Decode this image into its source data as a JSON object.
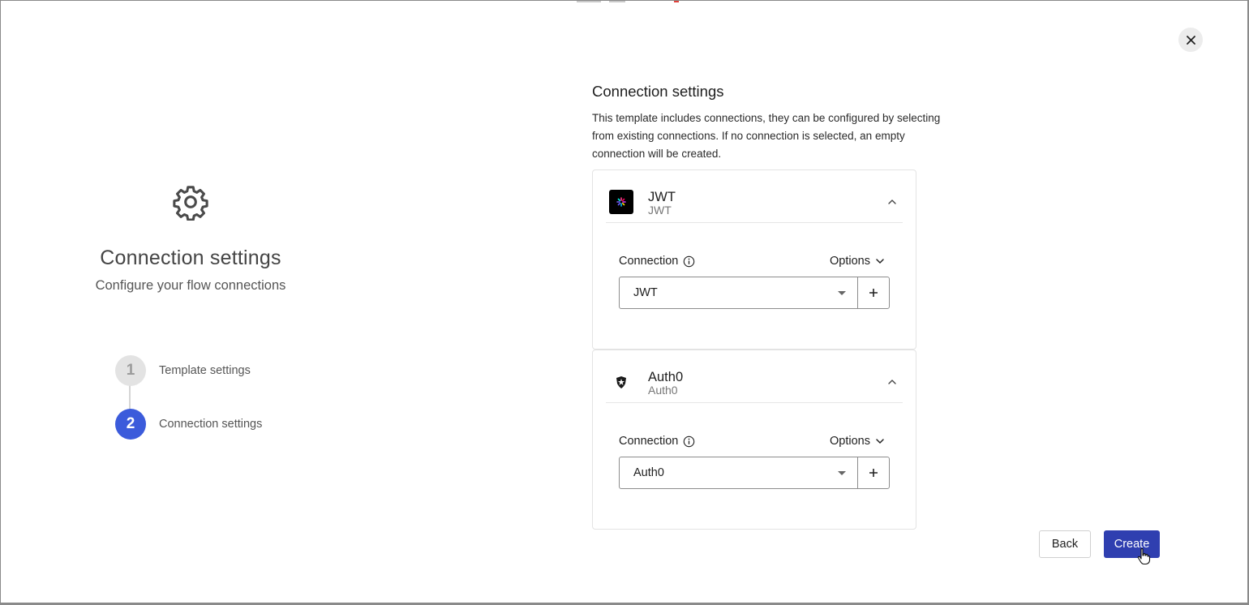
{
  "dialog": {
    "close_icon": "close-icon"
  },
  "left": {
    "icon": "gear-icon",
    "title": "Connection settings",
    "subtitle": "Configure your flow connections",
    "steps": [
      {
        "number": "1",
        "label": "Template settings",
        "state": "done"
      },
      {
        "number": "2",
        "label": "Connection settings",
        "state": "active"
      }
    ]
  },
  "right": {
    "title": "Connection settings",
    "description": "This template includes connections, they can be configured by selecting from existing connections. If no connection is selected, an empty connection will be created.",
    "connections": [
      {
        "name": "JWT",
        "type": "JWT",
        "icon": "jwt-logo-icon",
        "connection_label": "Connection",
        "options_label": "Options",
        "selected": "JWT"
      },
      {
        "name": "Auth0",
        "type": "Auth0",
        "icon": "auth0-logo-icon",
        "connection_label": "Connection",
        "options_label": "Options",
        "selected": "Auth0"
      }
    ]
  },
  "footer": {
    "back_label": "Back",
    "create_label": "Create"
  },
  "colors": {
    "primary": "#2f3fb0",
    "step_active": "#3b5bdb",
    "step_inactive": "#e3e3e3"
  }
}
